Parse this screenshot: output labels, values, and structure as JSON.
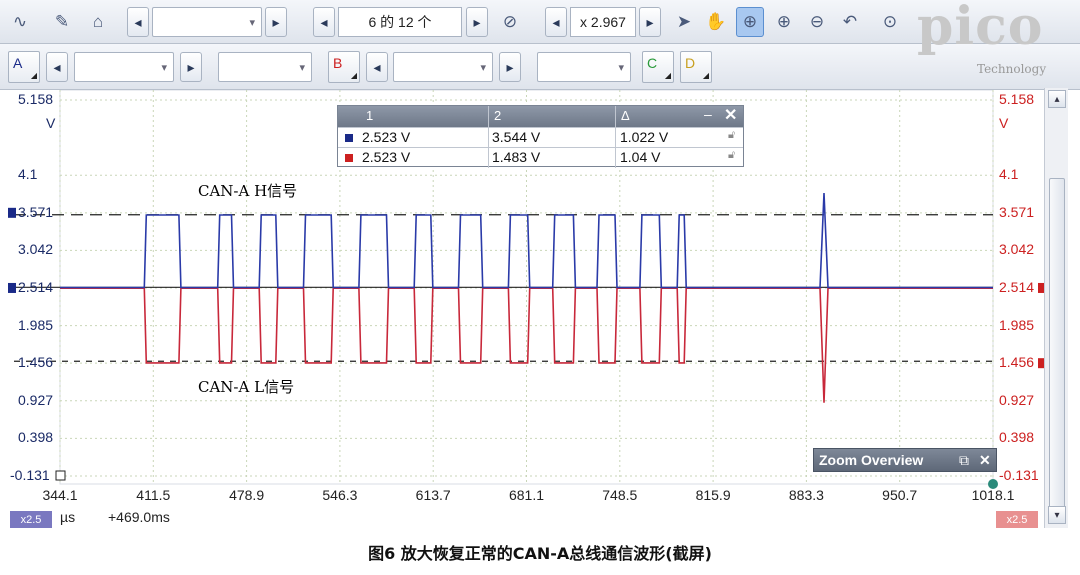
{
  "toolbar": {
    "capture_position": "6 的 12 个",
    "zoom_factor": "x 2.967"
  },
  "channels": {
    "a": "A",
    "b": "B",
    "c": "C",
    "d": "D"
  },
  "logo": {
    "brand": "pico",
    "subtitle": "Technology"
  },
  "axes": {
    "left_ticks": [
      "5.158",
      "4.1",
      "3.571",
      "3.042",
      "2.514",
      "1.985",
      "1.456",
      "0.927",
      "0.398",
      "-0.131"
    ],
    "left_unit": "V",
    "right_ticks": [
      "5.158",
      "4.1",
      "3.571",
      "3.042",
      "2.514",
      "1.985",
      "1.456",
      "0.927",
      "0.398",
      "-0.131"
    ],
    "right_unit": "V",
    "x_ticks": [
      "344.1",
      "411.5",
      "478.9",
      "546.3",
      "613.7",
      "681.1",
      "748.5",
      "815.9",
      "883.3",
      "950.7",
      "1018.1"
    ]
  },
  "signals": {
    "h_label": "CAN-A  H信号",
    "l_label": "CAN-A  L信号",
    "h_color": "#2a3aa8",
    "l_color": "#c8283a"
  },
  "measurements": {
    "headers": [
      "1",
      "2",
      "Δ"
    ],
    "rows": [
      {
        "color": "#1a2a88",
        "v1": "2.523 V",
        "v2": "3.544 V",
        "delta": "1.022 V"
      },
      {
        "color": "#cc2020",
        "v1": "2.523 V",
        "v2": "1.483 V",
        "delta": "1.04 V"
      }
    ]
  },
  "status": {
    "left_zoom": "x2.5",
    "right_zoom": "x2.5",
    "x_unit": "µs",
    "x_offset": "+469.0ms"
  },
  "zoom_overview": {
    "title": "Zoom Overview"
  },
  "caption": "图6    放大恢复正常的CAN-A总线通信波形(截屏)"
}
